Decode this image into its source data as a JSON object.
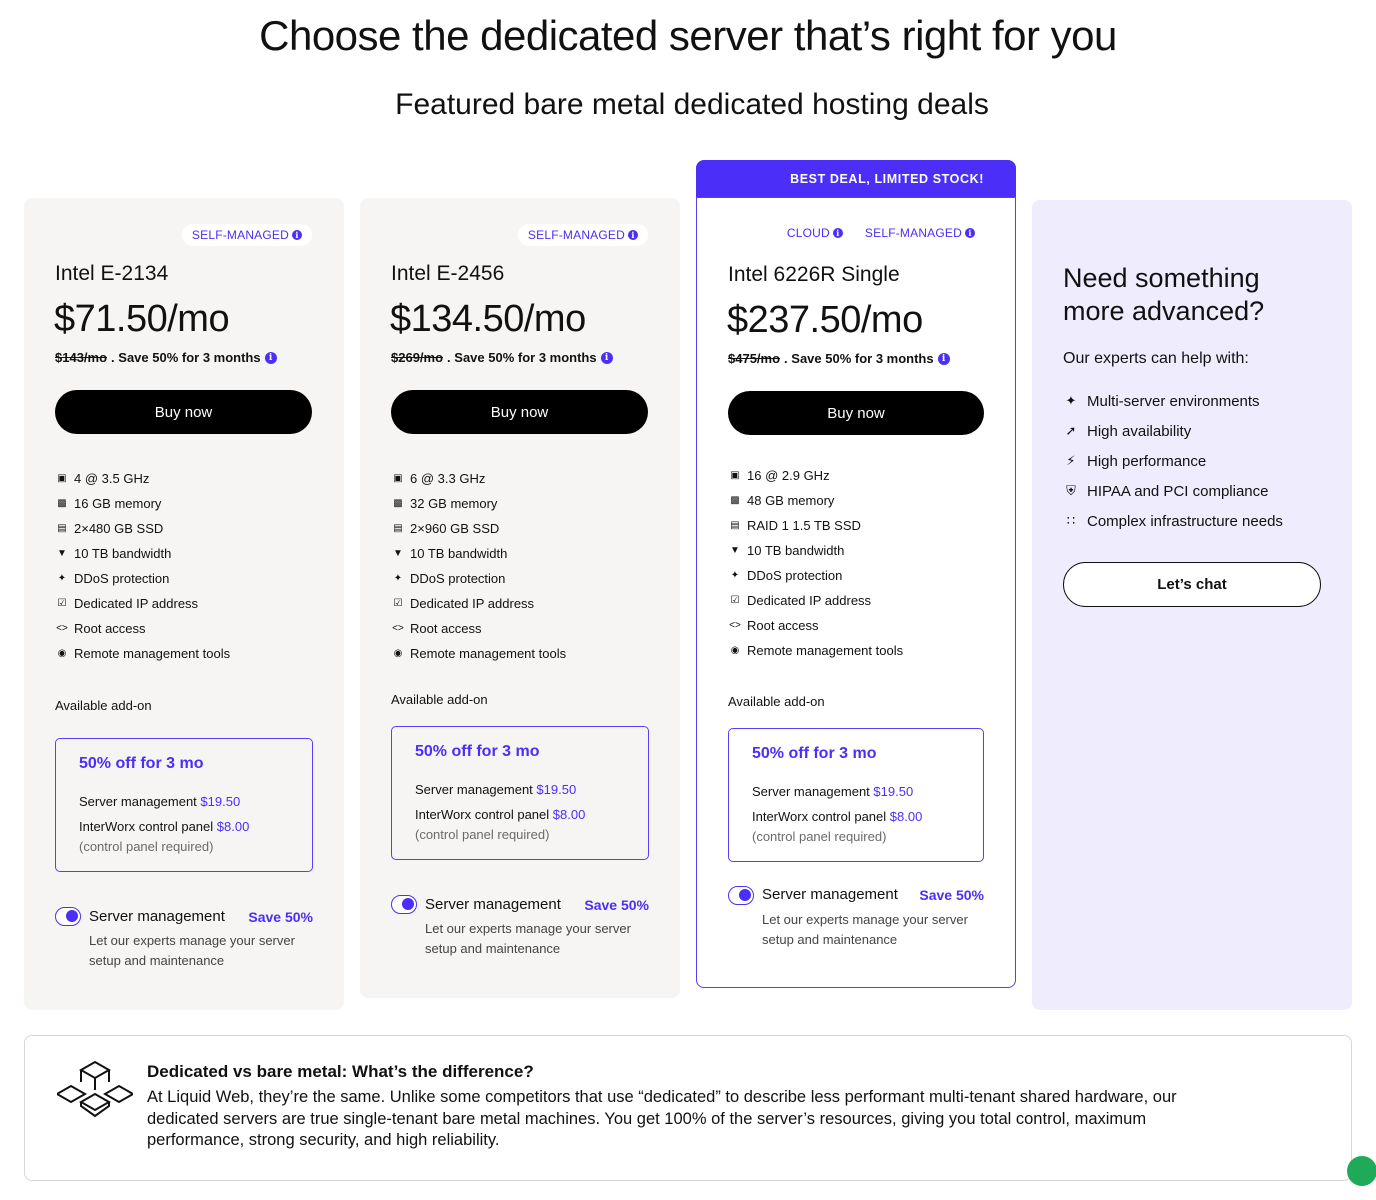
{
  "heading": "Choose the dedicated server that’s right for you",
  "subheading": "Featured bare metal dedicated hosting deals",
  "ribbon": "BEST DEAL, LIMITED STOCK!",
  "plans": [
    {
      "badges": [
        "SELF-MANAGED"
      ],
      "cpu": "Intel E-2134",
      "price": "$71.50/mo",
      "old_price": "$143/mo",
      "promo": ". Save 50% for 3 months",
      "buy": "Buy now",
      "specs": [
        "4 @ 3.5 GHz",
        "16 GB memory",
        "2×480 GB SSD",
        "10 TB bandwidth",
        "DDoS protection",
        "Dedicated IP address",
        "Root access",
        "Remote management tools"
      ],
      "addon_label": "Available add-on",
      "addon_title": "50% off for 3 mo",
      "addon_row1": "Server management ",
      "addon_row1_price": "$19.50",
      "addon_row2": "InterWorx control panel ",
      "addon_row2_price": "$8.00",
      "addon_row3": "(control panel required)",
      "sm_title": "Server management",
      "sm_save": "Save 50%",
      "sm_desc": "Let our experts manage your server setup and maintenance"
    },
    {
      "badges": [
        "SELF-MANAGED"
      ],
      "cpu": "Intel E-2456",
      "price": "$134.50/mo",
      "old_price": "$269/mo",
      "promo": ". Save 50% for 3 months",
      "buy": "Buy now",
      "specs": [
        "6 @ 3.3 GHz",
        "32 GB memory",
        "2×960 GB SSD",
        "10 TB bandwidth",
        "DDoS protection",
        "Dedicated IP address",
        "Root access",
        "Remote management tools"
      ],
      "addon_label": "Available add-on",
      "addon_title": "50% off for 3 mo",
      "addon_row1": "Server management ",
      "addon_row1_price": "$19.50",
      "addon_row2": "InterWorx control panel ",
      "addon_row2_price": "$8.00",
      "addon_row3": "(control panel required)",
      "sm_title": "Server management",
      "sm_save": "Save 50%",
      "sm_desc": "Let our experts manage your server setup and maintenance"
    },
    {
      "badges": [
        "CLOUD",
        "SELF-MANAGED"
      ],
      "cpu": "Intel 6226R Single",
      "price": "$237.50/mo",
      "old_price": "$475/mo",
      "promo": ". Save 50% for 3 months",
      "buy": "Buy now",
      "specs": [
        "16 @ 2.9 GHz",
        "48 GB memory",
        "RAID 1 1.5 TB SSD",
        "10 TB bandwidth",
        "DDoS protection",
        "Dedicated IP address",
        "Root access",
        "Remote management tools"
      ],
      "addon_label": "Available add-on",
      "addon_title": "50% off for 3 mo",
      "addon_row1": "Server management ",
      "addon_row1_price": "$19.50",
      "addon_row2": "InterWorx control panel ",
      "addon_row2_price": "$8.00",
      "addon_row3": "(control panel required)",
      "sm_title": "Server management",
      "sm_save": "Save 50%",
      "sm_desc": "Let our experts manage your server setup and maintenance"
    }
  ],
  "advanced": {
    "title": "Need something more advanced?",
    "subtitle": "Our experts can help with:",
    "items": [
      "Multi-server environments",
      "High availability",
      "High performance",
      "HIPAA and PCI compliance",
      "Complex infrastructure needs"
    ],
    "chat": "Let’s chat"
  },
  "difference": {
    "title": "Dedicated vs bare metal: What’s the difference?",
    "body": "At Liquid Web, they’re the same. Unlike some competitors that use “dedicated” to describe less performant multi-tenant shared hardware, our dedicated servers are true single-tenant bare metal machines. You get 100% of the server’s resources, giving you total control, maximum performance, strong security, and high reliability."
  },
  "icons": {
    "info": "info-icon",
    "specs": [
      "cpu-icon",
      "memory-icon",
      "ssd-icon",
      "bandwidth-icon",
      "ddos-icon",
      "ip-address-icon",
      "root-access-icon",
      "remote-tools-icon"
    ],
    "advanced": [
      "multi-server-icon",
      "availability-icon",
      "performance-icon",
      "compliance-icon",
      "infrastructure-icon"
    ],
    "difference": "cubes-icon"
  },
  "colors": {
    "accent": "#4b2ef7",
    "card_bg": "#f6f5f4",
    "advanced_bg": "#efedfd"
  }
}
